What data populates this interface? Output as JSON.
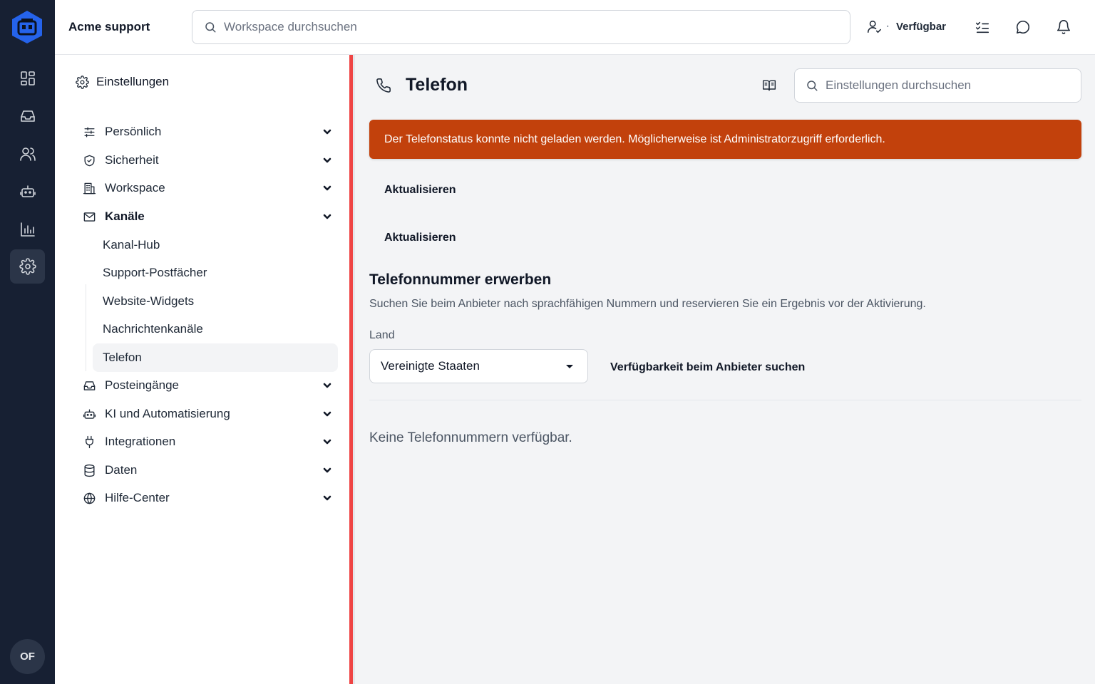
{
  "topbar": {
    "brand": "Acme support",
    "search_placeholder": "Workspace durchsuchen",
    "status_label": "Verfügbar",
    "status_separator": "·"
  },
  "rail": {
    "items": [
      "dashboard-icon",
      "inbox-icon",
      "contacts-icon",
      "bot-icon",
      "reports-icon",
      "settings-icon"
    ],
    "active": "settings-icon",
    "avatar_initials": "OF"
  },
  "sidebar": {
    "header": "Einstellungen",
    "items": [
      {
        "label": "Persönlich",
        "icon": "sliders-icon"
      },
      {
        "label": "Sicherheit",
        "icon": "shield-icon"
      },
      {
        "label": "Workspace",
        "icon": "building-icon"
      },
      {
        "label": "Kanäle",
        "icon": "mail-icon"
      },
      {
        "label": "Posteingänge",
        "icon": "inbox-icon"
      },
      {
        "label": "KI und Automatisierung",
        "icon": "bot-icon"
      },
      {
        "label": "Integrationen",
        "icon": "plug-icon"
      },
      {
        "label": "Daten",
        "icon": "database-icon"
      },
      {
        "label": "Hilfe-Center",
        "icon": "globe-icon"
      }
    ],
    "sub_items": [
      "Kanal-Hub",
      "Support-Postfächer",
      "Website-Widgets",
      "Nachrichtenkanäle",
      "Telefon"
    ],
    "active_sub": "Telefon"
  },
  "main": {
    "title": "Telefon",
    "settings_search_placeholder": "Einstellungen durchsuchen",
    "alert": "Der Telefonstatus konnte nicht geladen werden. Möglicherweise ist Administratorzugriff erforderlich.",
    "alert_color": "#c2410c",
    "refresh_1": "Aktualisieren",
    "refresh_2": "Aktualisieren",
    "section_title": "Telefonnummer erwerben",
    "section_desc": "Suchen Sie beim Anbieter nach sprachfähigen Nummern und reservieren Sie ein Ergebnis vor der Aktivierung.",
    "country_label": "Land",
    "country_value": "Vereinigte Staaten",
    "search_button": "Verfügbarkeit beim Anbieter suchen",
    "empty_text": "Keine Telefonnummern verfügbar."
  }
}
